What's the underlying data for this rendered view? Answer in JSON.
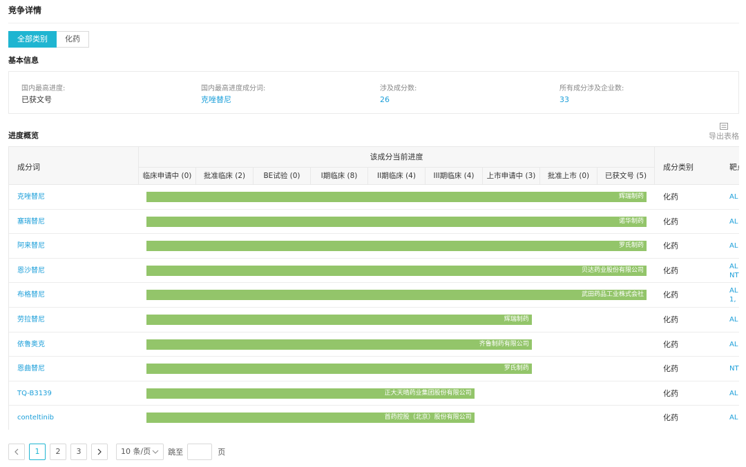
{
  "page": {
    "title": "竞争详情"
  },
  "tabs": [
    {
      "label": "全部类别",
      "active": true
    },
    {
      "label": "化药",
      "active": false
    }
  ],
  "basic_info": {
    "title": "基本信息",
    "items": [
      {
        "label": "国内最高进度:",
        "value": "已获文号"
      },
      {
        "label": "国内最高进度成分词:",
        "value": "克唑替尼"
      },
      {
        "label": "涉及成分数:",
        "value": "26"
      },
      {
        "label": "所有成分涉及企业数:",
        "value": "33"
      }
    ]
  },
  "progress": {
    "title": "进度概览",
    "export_label": "导出表格",
    "columns": {
      "name": "成分词",
      "stage_group": "该成分当前进度",
      "type": "成分类别",
      "target": "靶点"
    },
    "stages": [
      "临床申请中 (0)",
      "批准临床 (2)",
      "BE试验 (0)",
      "I期临床 (8)",
      "II期临床 (4)",
      "III期临床 (4)",
      "上市申请中 (3)",
      "批准上市 (0)",
      "已获文号 (5)"
    ],
    "rows": [
      {
        "name": "克唑替尼",
        "company": "辉瑞制药",
        "stage_reached": 9,
        "type": "化药",
        "target": [
          "AL"
        ]
      },
      {
        "name": "塞瑞替尼",
        "company": "诺华制药",
        "stage_reached": 9,
        "type": "化药",
        "target": [
          "AL"
        ]
      },
      {
        "name": "阿来替尼",
        "company": "罗氏制药",
        "stage_reached": 9,
        "type": "化药",
        "target": [
          "AL"
        ]
      },
      {
        "name": "恩沙替尼",
        "company": "贝达药业股份有限公司",
        "stage_reached": 9,
        "type": "化药",
        "target": [
          "AL",
          "NT"
        ]
      },
      {
        "name": "布格替尼",
        "company": "武田药品工业株式会社",
        "stage_reached": 9,
        "type": "化药",
        "target": [
          "AL",
          "1,"
        ]
      },
      {
        "name": "劳拉替尼",
        "company": "辉瑞制药",
        "stage_reached": 7,
        "type": "化药",
        "target": [
          "AL"
        ]
      },
      {
        "name": "依鲁奥克",
        "company": "齐鲁制药有限公司",
        "stage_reached": 7,
        "type": "化药",
        "target": [
          "AL"
        ]
      },
      {
        "name": "恩曲替尼",
        "company": "罗氏制药",
        "stage_reached": 7,
        "type": "化药",
        "target": [
          "NT"
        ]
      },
      {
        "name": "TQ-B3139",
        "company": "正大天晴药业集团股份有限公司",
        "stage_reached": 6,
        "type": "化药",
        "target": [
          "AL"
        ]
      },
      {
        "name": "conteltinib",
        "company": "首药控股（北京）股份有限公司",
        "stage_reached": 6,
        "type": "化药",
        "target": [
          "AL"
        ]
      }
    ]
  },
  "pagination": {
    "pages": [
      "1",
      "2",
      "3"
    ],
    "current": "1",
    "page_size": "10 条/页",
    "jump_label": "跳至",
    "page_unit": "页"
  }
}
